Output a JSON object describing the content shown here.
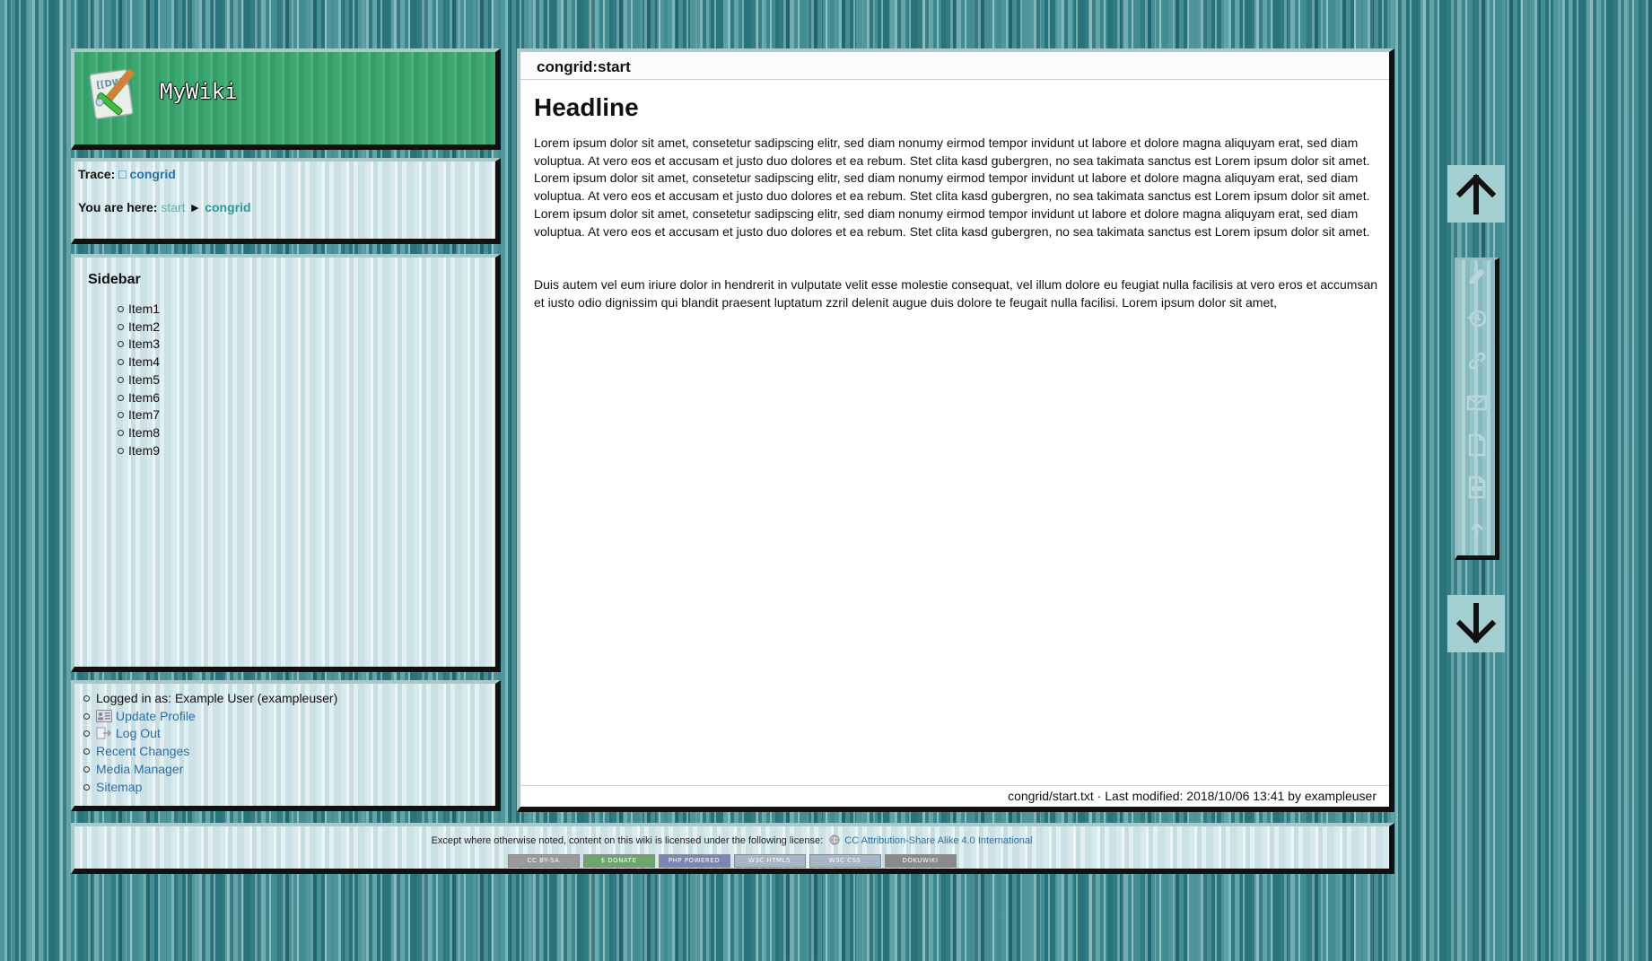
{
  "header": {
    "site_title": "MyWiki",
    "logo_icon": "dokuwiki-logo-icon"
  },
  "breadcrumbs": {
    "trace_label": "Trace:",
    "trace_marker": "□",
    "trace_item": "congrid",
    "here_label": "You are here:",
    "here_start": "start",
    "here_separator": "►",
    "here_current": "congrid"
  },
  "sidebar": {
    "title": "Sidebar",
    "items": [
      "Item1",
      "Item2",
      "Item3",
      "Item4",
      "Item5",
      "Item6",
      "Item7",
      "Item8",
      "Item9"
    ]
  },
  "user_tools": {
    "logged_in": "Logged in as: Example User (exampleuser)",
    "update_profile": "Update Profile",
    "log_out": "Log Out",
    "recent_changes": "Recent Changes",
    "media_manager": "Media Manager",
    "sitemap": "Sitemap"
  },
  "content": {
    "page_id": "congrid:start",
    "headline": "Headline",
    "paragraph1": "Lorem ipsum dolor sit amet, consetetur sadipscing elitr, sed diam nonumy eirmod tempor invidunt ut labore et dolore magna aliquyam erat, sed diam voluptua. At vero eos et accusam et justo duo dolores et ea rebum. Stet clita kasd gubergren, no sea takimata sanctus est Lorem ipsum dolor sit amet. Lorem ipsum dolor sit amet, consetetur sadipscing elitr, sed diam nonumy eirmod tempor invidunt ut labore et dolore magna aliquyam erat, sed diam voluptua. At vero eos et accusam et justo duo dolores et ea rebum. Stet clita kasd gubergren, no sea takimata sanctus est Lorem ipsum dolor sit amet. Lorem ipsum dolor sit amet, consetetur sadipscing elitr, sed diam nonumy eirmod tempor invidunt ut labore et dolore magna aliquyam erat, sed diam voluptua. At vero eos et accusam et justo duo dolores et ea rebum. Stet clita kasd gubergren, no sea takimata sanctus est Lorem ipsum dolor sit amet.",
    "paragraph2": "Duis autem vel eum iriure dolor in hendrerit in vulputate velit esse molestie consequat, vel illum dolore eu feugiat nulla facilisis at vero eros et accumsan et iusto odio dignissim qui blandit praesent luptatum zzril delenit augue duis dolore te feugait nulla facilisi. Lorem ipsum dolor sit amet,",
    "doc_info": "congrid/start.txt · Last modified: 2018/10/06 13:41 by exampleuser"
  },
  "footer": {
    "license_text": "Except where otherwise noted, content on this wiki is licensed under the following license:",
    "license_link": "CC Attribution-Share Alike 4.0 International",
    "badges": [
      "CC BY-SA",
      "$ DONATE",
      "PHP POWERED",
      "W3C HTML5",
      "W3C CSS",
      "DOKUWIKI"
    ]
  },
  "page_tools": {
    "top_button_icon": "arrow-up-icon",
    "bottom_button_icon": "arrow-down-icon",
    "tools": [
      "edit-icon",
      "history-icon",
      "backlinks-icon",
      "email-icon",
      "odt-export-icon",
      "pdf-export-icon",
      "back-to-top-icon"
    ]
  },
  "colors": {
    "header_green": "#3aa86f",
    "link_blue": "#2b6fa8",
    "link_teal": "#2c9a9a",
    "background_teal": "#3a8c92"
  }
}
